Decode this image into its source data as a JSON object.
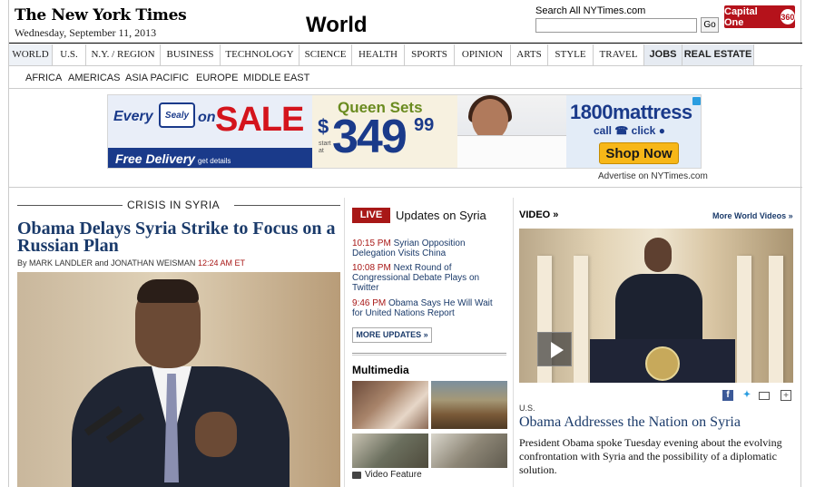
{
  "masthead": {
    "logo": "The New York Times",
    "date": "Wednesday, September 11, 2013",
    "section": "World",
    "search_label": "Search All NYTimes.com",
    "search_value": "",
    "go_label": "Go",
    "sponsor_text": "Capital One",
    "sponsor_badge": "360"
  },
  "nav": {
    "items": [
      {
        "label": "WORLD"
      },
      {
        "label": "U.S."
      },
      {
        "label": "N.Y. / REGION"
      },
      {
        "label": "BUSINESS"
      },
      {
        "label": "TECHNOLOGY"
      },
      {
        "label": "SCIENCE"
      },
      {
        "label": "HEALTH"
      },
      {
        "label": "SPORTS"
      },
      {
        "label": "OPINION"
      },
      {
        "label": "ARTS"
      },
      {
        "label": "STYLE"
      },
      {
        "label": "TRAVEL"
      },
      {
        "label": "JOBS"
      },
      {
        "label": "REAL ESTATE"
      }
    ],
    "subitems": [
      {
        "label": "AFRICA"
      },
      {
        "label": "AMERICAS"
      },
      {
        "label": "ASIA PACIFIC"
      },
      {
        "label": "EUROPE"
      },
      {
        "label": "MIDDLE EAST"
      }
    ]
  },
  "ad": {
    "every": "Every",
    "brand": "Sealy",
    "on": "on",
    "sale": "SALE",
    "delivery": "Free Delivery",
    "delivery_small": "get details",
    "queen": "Queen Sets",
    "dollar": "$",
    "start_at": "start at",
    "price": "349",
    "cents": "99",
    "phone": "1800mattress",
    "call": "call",
    "click": "click",
    "shop": "Shop Now",
    "advertise_link": "Advertise on NYTimes.com"
  },
  "lead": {
    "kicker": "CRISIS IN SYRIA",
    "headline": "Obama Delays Syria Strike to Focus on a Russian Plan",
    "byline_prefix": "By ",
    "author1": "MARK LANDLER",
    "and": " and ",
    "author2": "JONATHAN WEISMAN",
    "time": "12:24 AM ET"
  },
  "live": {
    "badge": "LIVE",
    "title": "Updates on Syria",
    "updates": [
      {
        "time": "10:15 PM",
        "text": "Syrian Opposition Delegation Visits China"
      },
      {
        "time": "10:08 PM",
        "text": "Next Round of Congressional Debate Plays on Twitter"
      },
      {
        "time": "9:46 PM",
        "text": "Obama Says He Will Wait for United Nations Report"
      }
    ],
    "more_label": "MORE UPDATES »"
  },
  "multimedia": {
    "title": "Multimedia",
    "video_feature": "Video Feature"
  },
  "video": {
    "header": "VIDEO »",
    "more": "More World Videos »",
    "section": "U.S.",
    "headline": "Obama Addresses the Nation on Syria",
    "summary": "President Obama spoke Tuesday evening about the evolving confrontation with Syria and the possibility of a diplomatic solution."
  }
}
